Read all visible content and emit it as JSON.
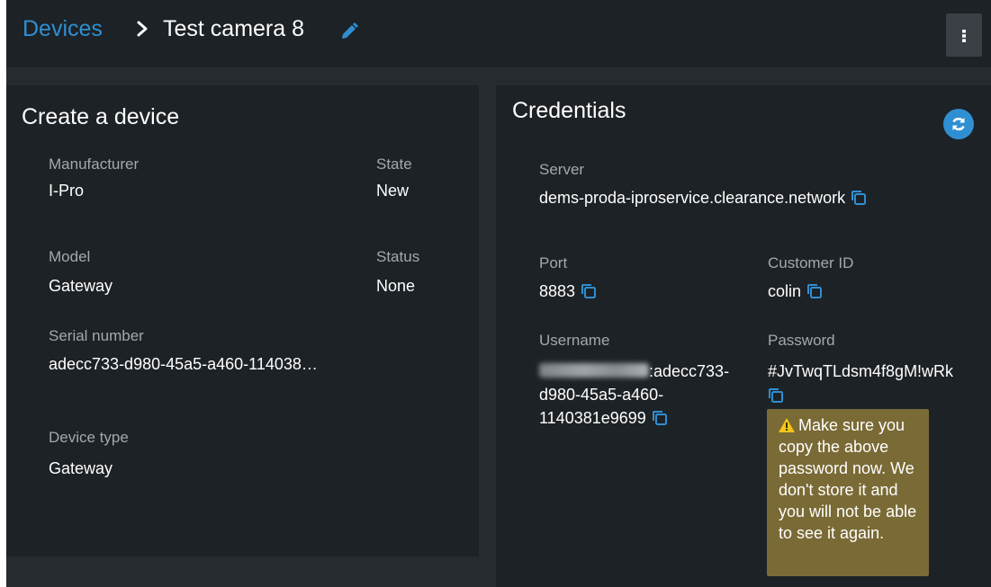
{
  "header": {
    "breadcrumb_link": "Devices",
    "title": "Test camera 8",
    "edit_icon": "pencil-icon",
    "menu_icon": "vertical-ellipsis-icon"
  },
  "device": {
    "heading": "Create a device",
    "manufacturer_label": "Manufacturer",
    "manufacturer_value": "I-Pro",
    "state_label": "State",
    "state_value": "New",
    "model_label": "Model",
    "model_value": "Gateway",
    "status_label": "Status",
    "status_value": "None",
    "serial_label": "Serial number",
    "serial_value": "adecc733-d980-45a5-a460-114038…",
    "type_label": "Device type",
    "type_value": "Gateway"
  },
  "credentials": {
    "heading": "Credentials",
    "refresh_icon": "refresh-icon",
    "server_label": "Server",
    "server_value": "dems-proda-iproservice.clearance.network",
    "port_label": "Port",
    "port_value": "8883",
    "customer_label": "Customer ID",
    "customer_value": "colin",
    "username_label": "Username",
    "username_line1": ":adecc733-",
    "username_line2": "d980-45a5-a460-",
    "username_line3": "1140381e9699",
    "password_label": "Password",
    "password_value": "#JvTwqTLdsm4f8gM!wRk",
    "warning_text": "Make sure you copy the above password now. We don't store it and you will not be able to see it again."
  },
  "colors": {
    "accent": "#2f8fd2",
    "background": "#262b2f",
    "panel": "#1d2226",
    "warning": "#7a6a35",
    "warning_icon": "#f5c518"
  }
}
